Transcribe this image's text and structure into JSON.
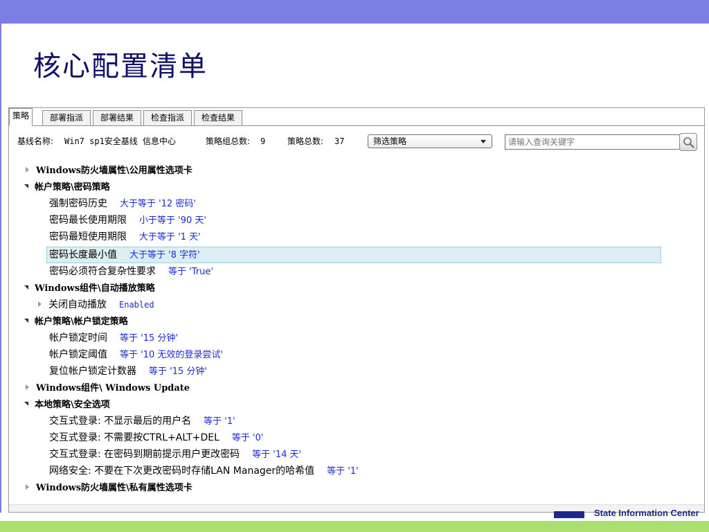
{
  "slide": {
    "title": "核心配置清单",
    "footer_logo_text": "State Information Center"
  },
  "tabs": [
    {
      "label": "策略",
      "active": true
    },
    {
      "label": "部署指派",
      "active": false
    },
    {
      "label": "部署结果",
      "active": false
    },
    {
      "label": "检查指派",
      "active": false
    },
    {
      "label": "检查结果",
      "active": false
    }
  ],
  "filterbar": {
    "baseline_label": "基线名称:",
    "baseline_value": "Win7 sp1安全基线 信息中心",
    "group_total_label": "策略组总数:",
    "group_total_value": "9",
    "policy_total_label": "策略总数:",
    "policy_total_value": "37",
    "filter_select": "筛选策略",
    "search_placeholder": "请输入查询关键字"
  },
  "tree": {
    "groups": [
      {
        "label": "Windows防火墙属性\\公用属性选项卡",
        "expanded": false
      },
      {
        "label": "帐户策略\\密码策略",
        "expanded": true
      },
      {
        "label": "Windows组件\\自动播放策略",
        "expanded": true
      },
      {
        "label": "帐户策略\\帐户锁定策略",
        "expanded": true
      },
      {
        "label": "Windows组件\\ Windows Update",
        "expanded": false
      },
      {
        "label": "本地策略\\安全选项",
        "expanded": true
      },
      {
        "label": "Windows防火墙属性\\私有属性选项卡",
        "expanded": false
      }
    ],
    "items": [
      {
        "label": "强制密码历史",
        "value": "大于等于 '12 密码'"
      },
      {
        "label": "密码最长使用期限",
        "value": "小于等于 '90 天'"
      },
      {
        "label": "密码最短使用期限",
        "value": "大于等于 '1 天'"
      },
      {
        "label": "密码长度最小值",
        "value": "大于等于 '8 字符'"
      },
      {
        "label": "密码必须符合复杂性要求",
        "value": "等于 'True'"
      },
      {
        "label": "关闭自动播放",
        "value": "Enabled"
      },
      {
        "label": "帐户锁定时间",
        "value": "等于 '15 分钟'"
      },
      {
        "label": "帐户锁定阈值",
        "value": "等于 '10 无效的登录尝试'"
      },
      {
        "label": "复位帐户锁定计数器",
        "value": "等于 '15 分钟'"
      },
      {
        "label": "交互式登录: 不显示最后的用户名",
        "value": "等于 '1'"
      },
      {
        "label": "交互式登录: 不需要按CTRL+ALT+DEL",
        "value": "等于 '0'"
      },
      {
        "label": "交互式登录: 在密码到期前提示用户更改密码",
        "value": "等于 '14 天'"
      },
      {
        "label": "网络安全: 不要在下次更改密码时存储LAN Manager的哈希值",
        "value": "等于 '1'"
      }
    ]
  },
  "colors": {
    "top_bar": "#7b7fe4",
    "title": "#10106a",
    "value_text": "#1a2ad8",
    "selection": "#dcedf4",
    "footer_green": "#a9df6f"
  }
}
